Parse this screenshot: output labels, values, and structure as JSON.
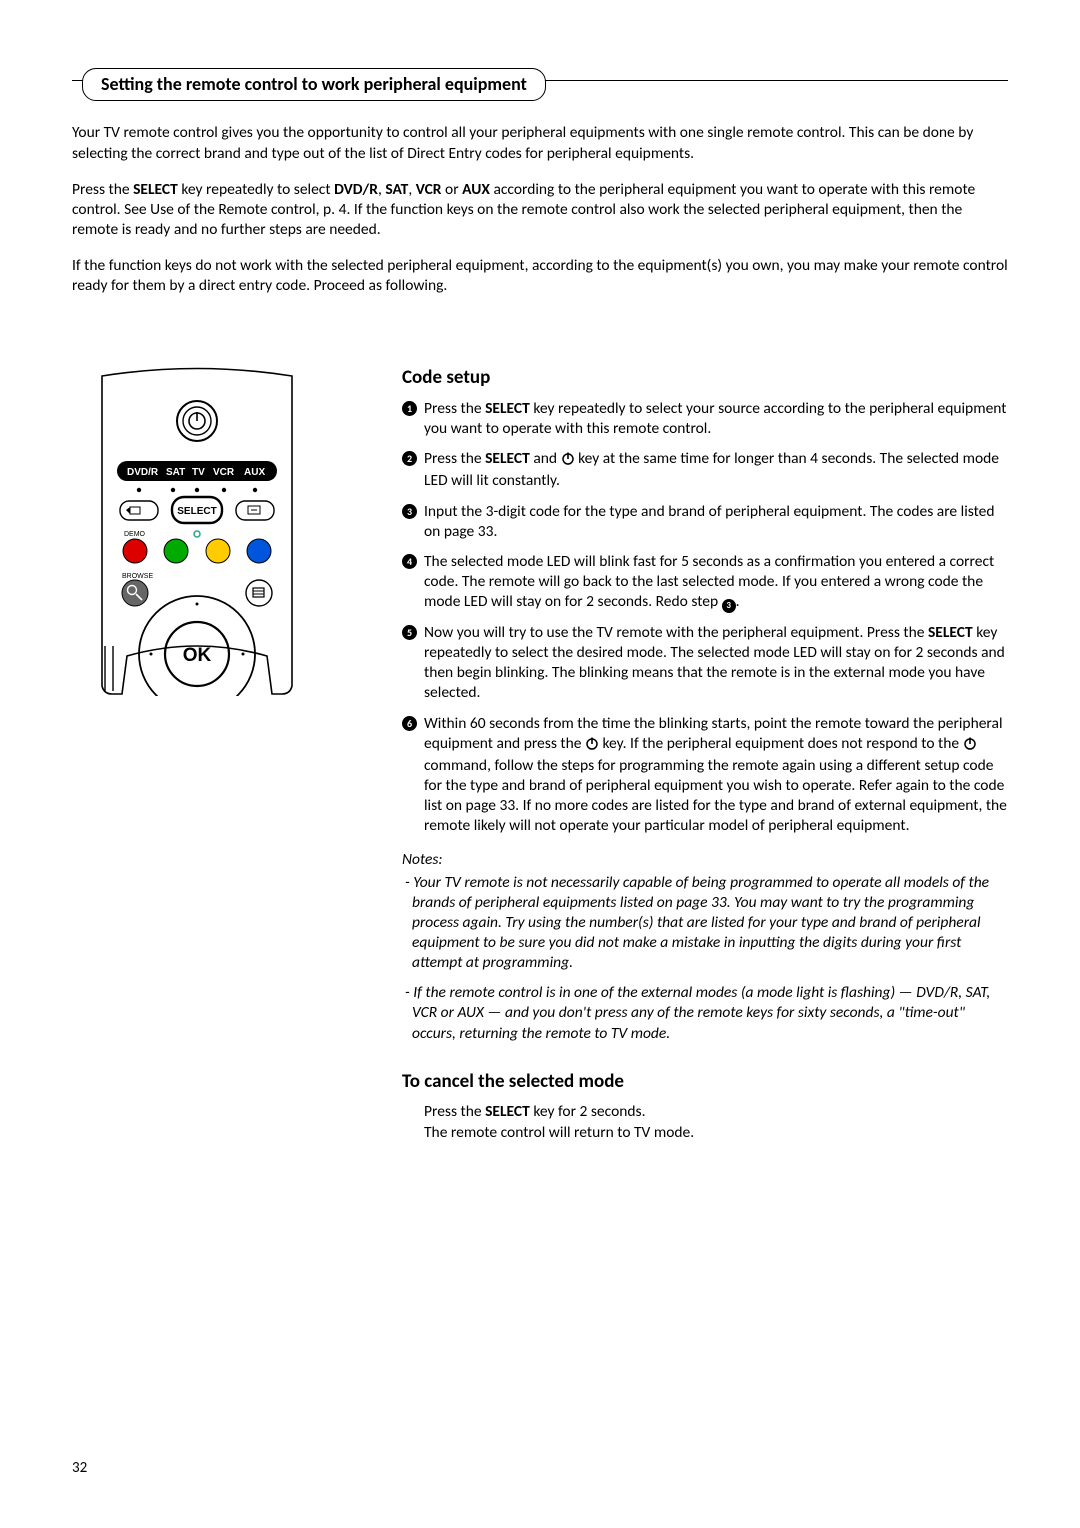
{
  "page_number": "32",
  "title": "Setting the remote control to work peripheral equipment",
  "intro": {
    "p1a": "Your TV remote control gives you the opportunity to control all your peripheral equipments with one single remote control. This can be done by selecting the correct brand and type out of the list of Direct Entry codes for peripheral equipments.",
    "p2a": "Press the ",
    "p2_select": "SELECT",
    "p2b": " key repeatedly to select ",
    "p2_dvdr": "DVD/R",
    "p2c": ", ",
    "p2_sat": "SAT",
    "p2d": ", ",
    "p2_vcr": "VCR",
    "p2e": " or ",
    "p2_aux": "AUX",
    "p2f": " according to the peripheral equipment you want to operate with this remote control. See Use of the Remote control, p. 4. If the function keys on the remote control also work the selected peripheral equipment, then the remote is ready and no further steps are needed.",
    "p3": "If the function keys do not work with the selected peripheral equipment, according to the equipment(s) you own, you may make your remote control ready for them by a direct entry code. Proceed as following."
  },
  "remote": {
    "modes": [
      "DVD/R",
      "SAT",
      "TV",
      "VCR",
      "AUX"
    ],
    "select_label": "SELECT",
    "ok_label": "OK",
    "demo_label": "DEMO",
    "browse_label": "BROWSE"
  },
  "code_setup": {
    "heading": "Code setup",
    "s1a": "Press the ",
    "s1_select": "SELECT",
    "s1b": " key repeatedly to select your source according to the peripheral equipment you want to operate with this remote control.",
    "s2a": "Press the ",
    "s2_select": "SELECT",
    "s2b": " and ",
    "s2c": " key at the same time for longer than 4 seconds. The selected mode LED will lit constantly.",
    "s3": "Input the 3-digit code for the type and brand of peripheral equipment. The codes are listed on page 33.",
    "s4a": "The selected mode LED will blink fast for 5 seconds as a confirmation you entered a correct code. The remote will go back to the last selected mode. If you entered a wrong code the mode LED will stay on for 2 seconds. Redo step ",
    "s4b": ".",
    "s5a": "Now you will try to use the TV remote with the peripheral equipment. Press the ",
    "s5_select": "SELECT",
    "s5b": " key repeatedly to select the desired mode. The selected mode LED will stay on for 2 seconds and then begin blinking. The blinking means that the remote is in the external mode you have selected.",
    "s6a": "Within 60 seconds from the time the blinking starts, point the remote toward the peripheral equipment and press the ",
    "s6b": " key. If the peripheral equipment does not respond to the ",
    "s6c": " command, follow the steps for programming the remote again using a different setup code for the type and brand of peripheral equipment you wish to operate. Refer again to the code list on page 33. If no more codes are listed for the type and brand of external equipment, the remote likely will not operate your particular model of peripheral equipment."
  },
  "notes": {
    "heading": "Notes:",
    "n1": "- Your TV remote is not necessarily capable of being programmed to operate all models of the brands of peripheral equipments listed on page 33. You may want to try the programming process again. Try using the number(s) that are listed for your type and brand of peripheral equipment to be sure you did not make a mistake in inputting the digits during your first attempt at programming.",
    "n2": "- If the remote control is in one of the external modes (a mode light is flashing) — DVD/R, SAT, VCR or AUX — and you don't press any of the remote keys for sixty seconds, a \"time-out\" occurs, returning the remote to TV mode."
  },
  "cancel": {
    "heading": "To cancel the selected mode",
    "l1a": "Press the ",
    "l1_select": "SELECT",
    "l1b": " key for 2 seconds.",
    "l2": "The remote control will return to TV mode."
  }
}
